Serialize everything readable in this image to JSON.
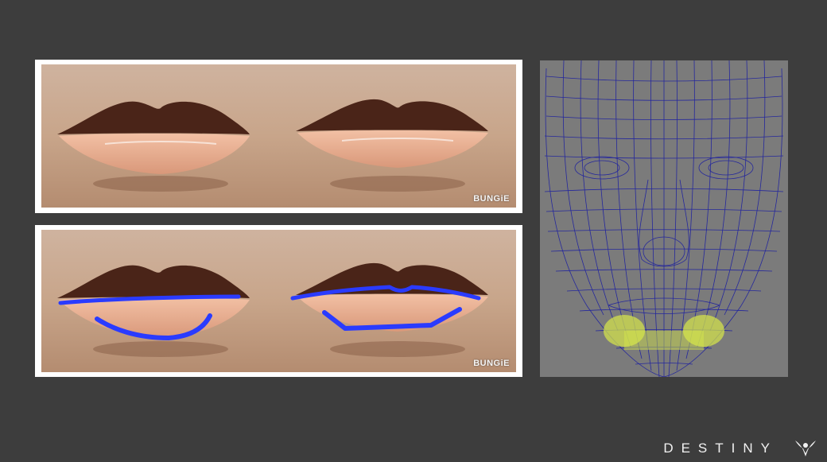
{
  "slide": {
    "watermark_top": "BUNGiE",
    "watermark_bottom": "BUNGiE",
    "brand_text": "DESTINY",
    "colors": {
      "background": "#3d3d3d",
      "stroke_annotation": "#2a3bff",
      "mesh_lines": "#1c1fa0",
      "mesh_highlight": "#d8e84a"
    },
    "icons": [
      "destiny-logo-icon"
    ]
  }
}
